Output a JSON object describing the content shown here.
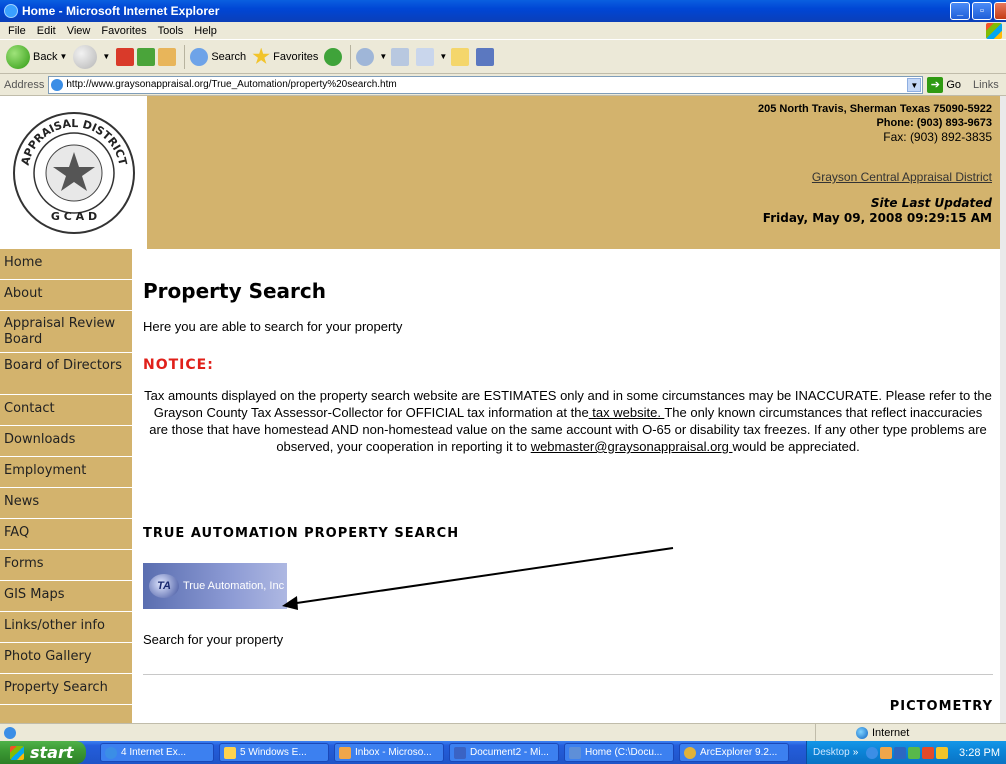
{
  "window": {
    "title": "Home - Microsoft Internet Explorer",
    "minimize": "_",
    "maximize": "▫",
    "close": "X"
  },
  "menu": [
    "File",
    "Edit",
    "View",
    "Favorites",
    "Tools",
    "Help"
  ],
  "toolbar": {
    "back": "Back",
    "search": "Search",
    "favorites": "Favorites"
  },
  "address": {
    "label": "Address",
    "url": "http://www.graysonappraisal.org/True_Automation/property%20search.htm",
    "go": "Go",
    "links": "Links"
  },
  "header": {
    "address_line": "205 North Travis, Sherman Texas 75090-5922",
    "phone": "Phone: (903) 893-9673",
    "fax": "Fax: (903) 892-3835",
    "district_link": "Grayson Central Appraisal District",
    "updated_label": "Site Last Updated",
    "updated_date": "Friday, May 09, 2008 09:29:15 AM",
    "seal_text": "APPRAISAL DISTRICT",
    "seal_bottom": "G C A D"
  },
  "nav": [
    {
      "label": "Home"
    },
    {
      "label": "About"
    },
    {
      "label": "Appraisal Review Board"
    },
    {
      "label": "Board of Directors"
    },
    {
      "label": "Contact"
    },
    {
      "label": "Downloads"
    },
    {
      "label": "Employment"
    },
    {
      "label": "News"
    },
    {
      "label": "FAQ"
    },
    {
      "label": "Forms"
    },
    {
      "label": "GIS Maps"
    },
    {
      "label": "Links/other info"
    },
    {
      "label": "Photo Gallery"
    },
    {
      "label": "Property Search"
    }
  ],
  "main": {
    "title": "Property Search",
    "intro": "Here you are able to search for your property",
    "notice_heading": "NOTICE:",
    "notice_part1": "Tax amounts displayed on the property search website are ESTIMATES only and in some circumstances may be INACCURATE.  Please refer to the Grayson County Tax Assessor-Collector for OFFICIAL tax information at the",
    "tax_link": " tax website. ",
    "notice_part2": " The only known circumstances that reflect inaccuracies are those that have homestead AND non-homestead value on the same account with O-65 or disability tax freezes.  If any other type problems are observed, your cooperation in reporting it to ",
    "email_link": "webmaster@graysonappraisal.org ",
    "notice_part3": "would be appreciated.",
    "ta_heading": "TRUE AUTOMATION PROPERTY SEARCH",
    "ta_logo_mark": "TA",
    "ta_logo_text": "True Automation, Inc",
    "search_link": "Search for your property",
    "pictometry": "PICTOMETRY"
  },
  "status": {
    "zone": "Internet"
  },
  "taskbar": {
    "start": "start",
    "tasks": [
      "4 Internet Ex...",
      "5 Windows E...",
      "Inbox - Microso...",
      "Document2 - Mi...",
      "Home (C:\\Docu...",
      "ArcExplorer 9.2..."
    ],
    "desktop": "Desktop",
    "clock": "3:28 PM"
  },
  "colors": {
    "header_bg": "#d3b36d",
    "nav_bg": "#d3b36d",
    "notice_red": "#e0201a"
  }
}
